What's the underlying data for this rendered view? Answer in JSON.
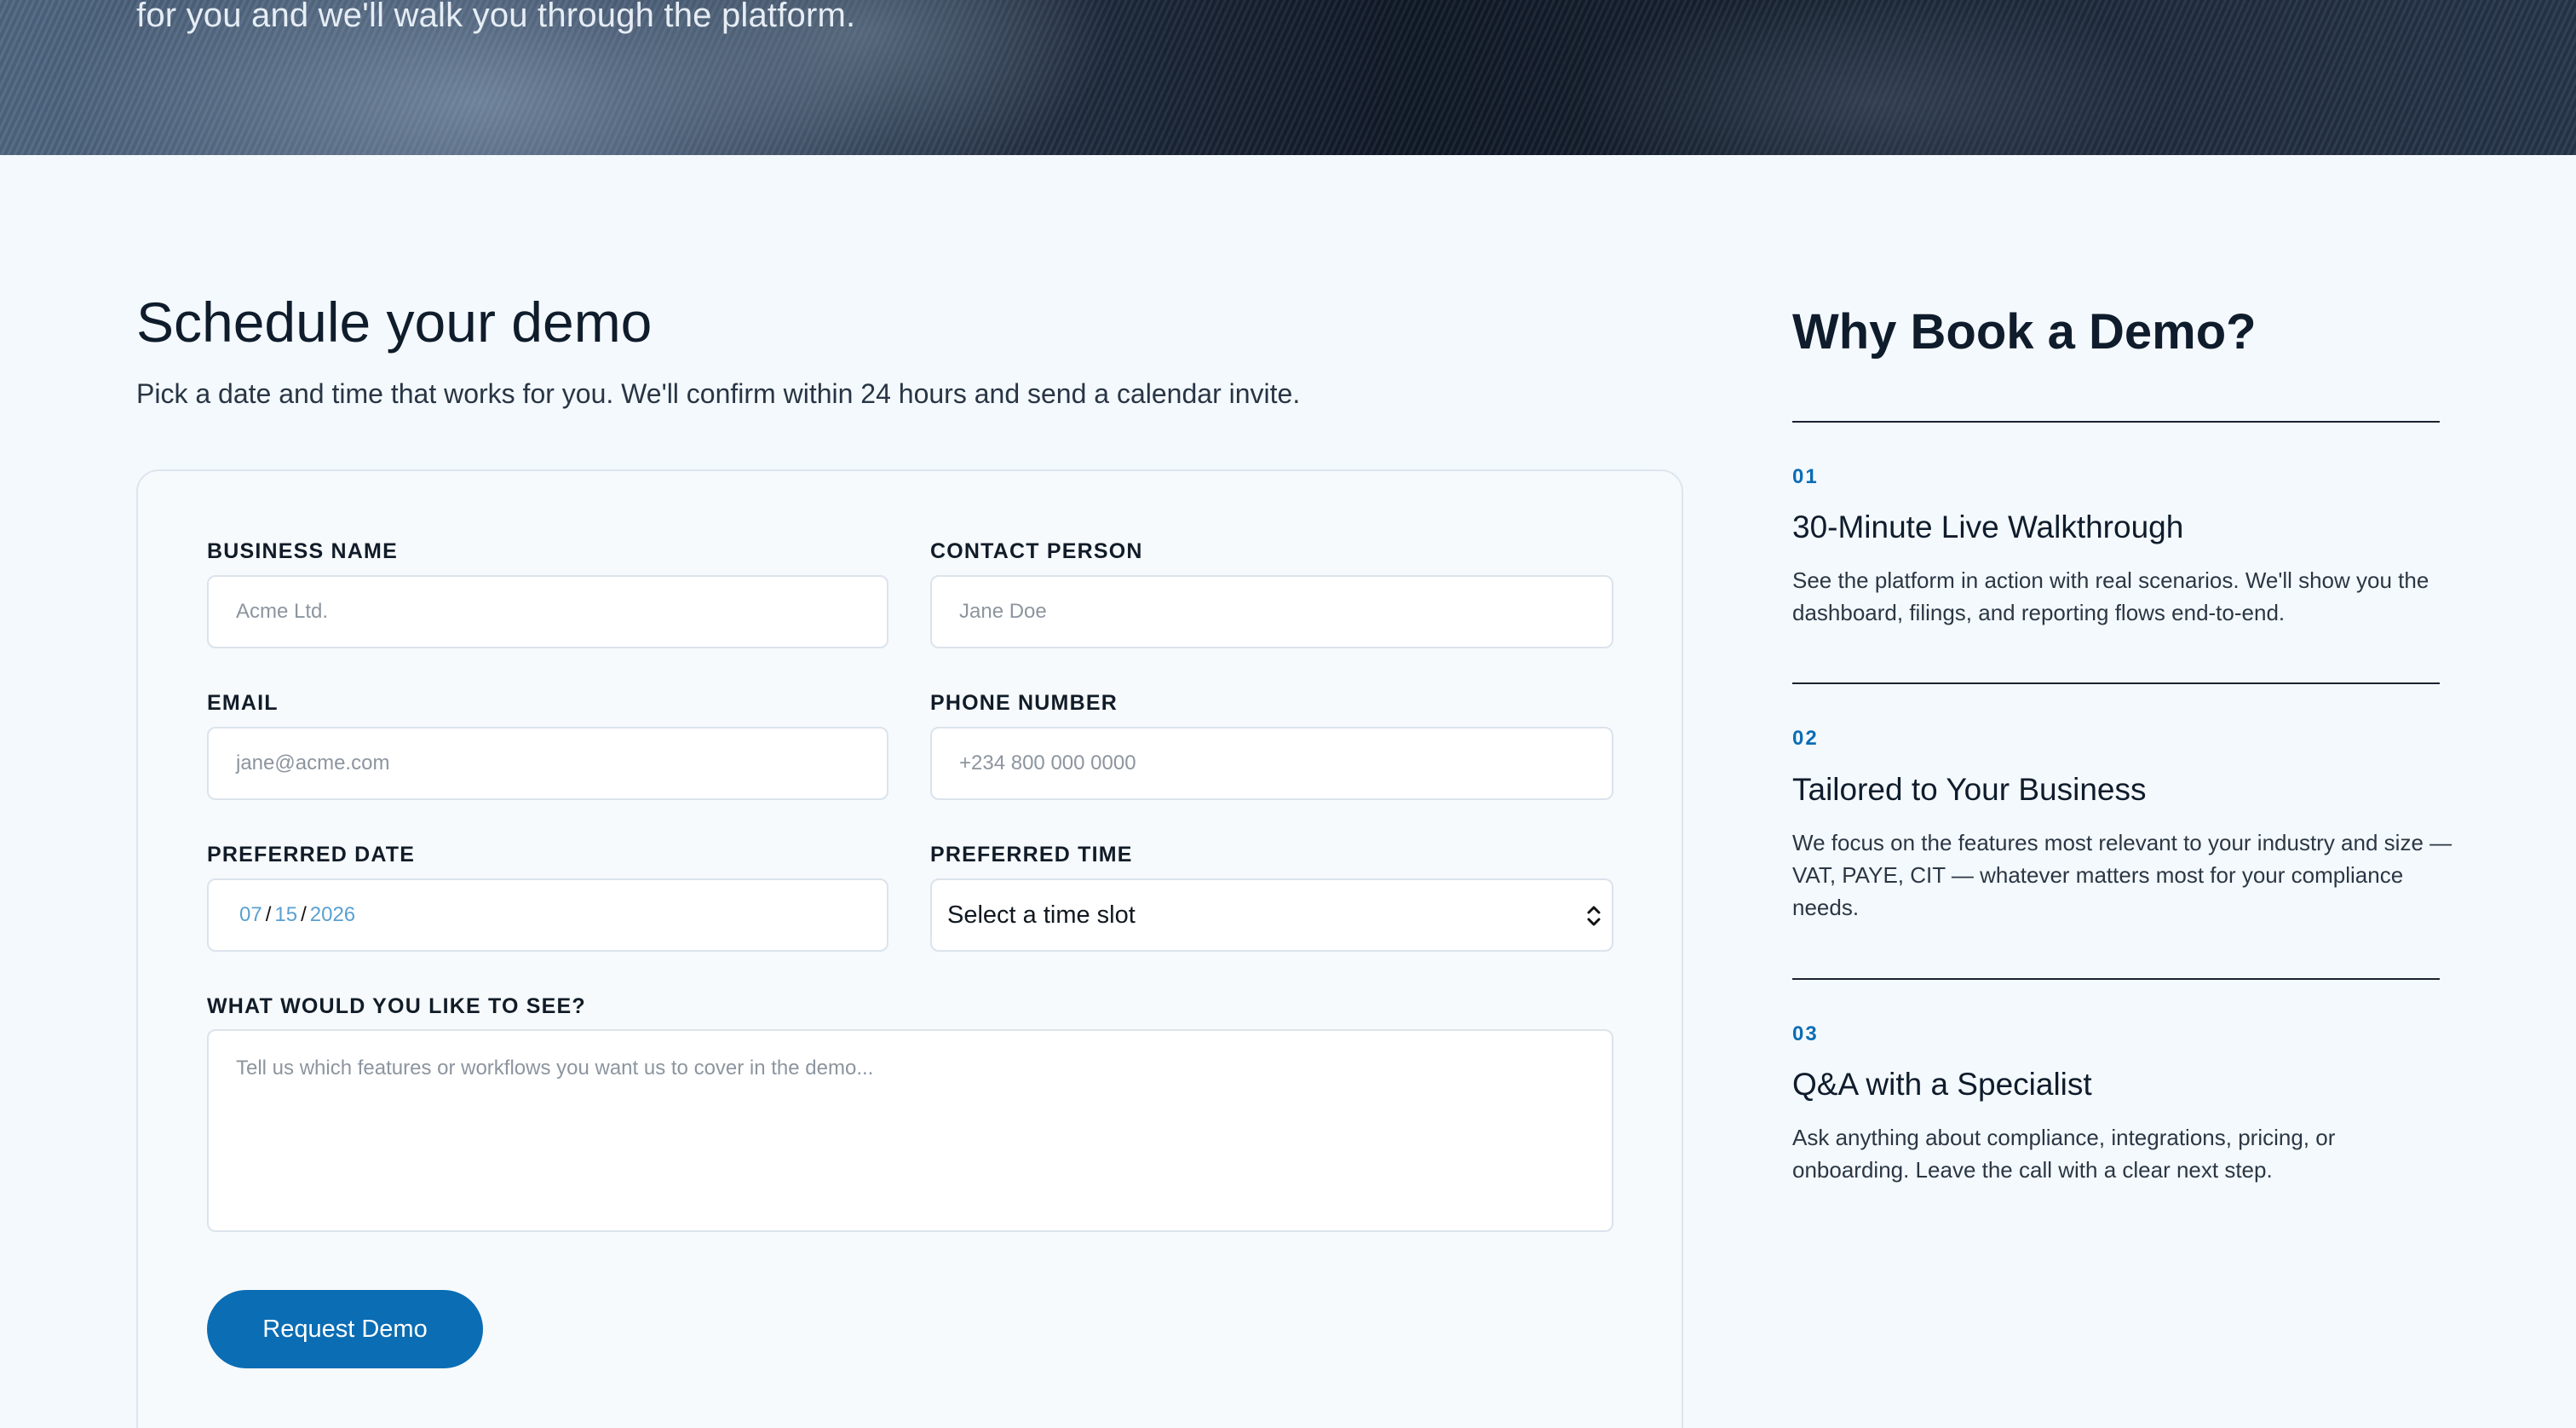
{
  "hero": {
    "subtitle": "for you and we'll walk you through the platform."
  },
  "form_section": {
    "title": "Schedule your demo",
    "description": "Pick a date and time that works for you. We'll confirm within 24 hours and send a calendar invite.",
    "fields": {
      "business_name": {
        "label": "BUSINESS NAME",
        "placeholder": "Acme Ltd."
      },
      "contact_person": {
        "label": "CONTACT PERSON",
        "placeholder": "Jane Doe"
      },
      "email": {
        "label": "EMAIL",
        "placeholder": "jane@acme.com"
      },
      "phone": {
        "label": "PHONE NUMBER",
        "placeholder": "+234 800 000 0000"
      },
      "preferred_date": {
        "label": "PREFERRED DATE",
        "month": "07",
        "day": "15",
        "year": "2026",
        "separator": "/"
      },
      "preferred_time": {
        "label": "PREFERRED TIME",
        "value": "Select a time slot"
      },
      "message": {
        "label": "WHAT WOULD YOU LIKE TO SEE?",
        "placeholder": "Tell us which features or workflows you want us to cover in the demo..."
      }
    },
    "submit_label": "Request Demo"
  },
  "why_section": {
    "title": "Why Book a Demo?",
    "reasons": [
      {
        "number": "01",
        "title": "30-Minute Live Walkthrough",
        "text": "See the platform in action with real scenarios. We'll show you the dashboard, filings, and reporting flows end-to-end."
      },
      {
        "number": "02",
        "title": "Tailored to Your Business",
        "text": "We focus on the features most relevant to your industry and size — VAT, PAYE, CIT — whatever matters most for your compliance needs."
      },
      {
        "number": "03",
        "title": "Q&A with a Specialist",
        "text": "Ask anything about compliance, integrations, pricing, or onboarding. Leave the call with a clear next step."
      }
    ]
  },
  "colors": {
    "accent": "#0b6db4",
    "page_bg": "#f4f9fd",
    "text": "#0f1c2c"
  }
}
